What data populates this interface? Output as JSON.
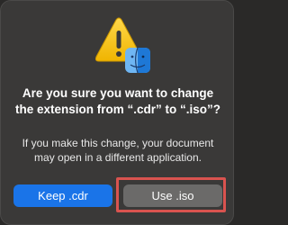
{
  "dialog": {
    "title": "Are you sure you want to change the extension from “.cdr” to “.iso”?",
    "message": "If you make this change, your document may open in a different application.",
    "icon": "warning-triangle-with-finder-icon"
  },
  "buttons": {
    "keep_label": "Keep .cdr",
    "use_label": "Use .iso"
  },
  "colors": {
    "dialog_bg": "#3a3938",
    "primary_button": "#1a74e8",
    "secondary_button": "#6b6a69",
    "highlight": "#d9534f",
    "warning_yellow": "#f5c518"
  }
}
